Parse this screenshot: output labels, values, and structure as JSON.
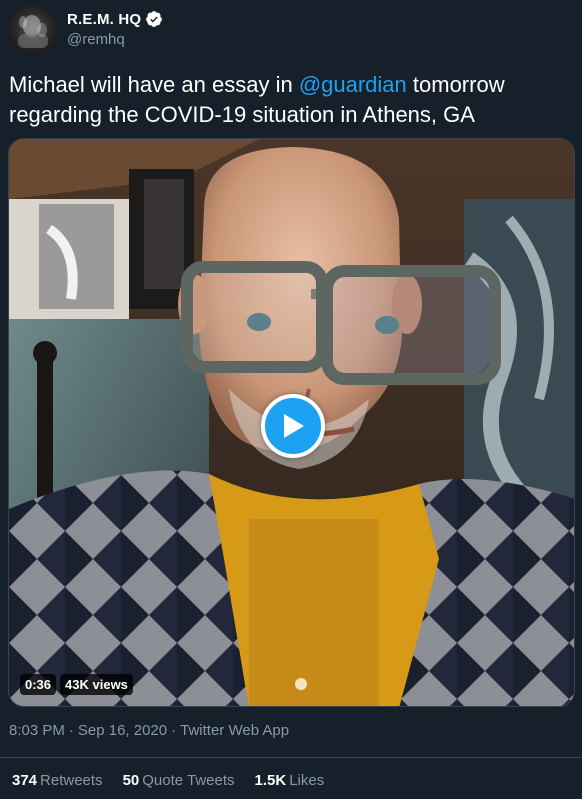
{
  "account": {
    "display_name": "R.E.M. HQ",
    "handle": "@remhq",
    "verified": true
  },
  "tweet": {
    "text_before": "Michael will have an essay in ",
    "mention": "@guardian",
    "text_after": " tomorrow regarding the COVID-19 situation in Athens, GA"
  },
  "video": {
    "duration": "0:36",
    "views": "43K views",
    "play_icon": "play-icon"
  },
  "meta": {
    "time": "8:03 PM",
    "separator": "·",
    "date": "Sep 16, 2020",
    "source": "Twitter Web App"
  },
  "stats": [
    {
      "count": "374",
      "label": "Retweets"
    },
    {
      "count": "50",
      "label": "Quote Tweets"
    },
    {
      "count": "1.5K",
      "label": "Likes"
    }
  ],
  "colors": {
    "background": "#15202b",
    "accent": "#1da1f2",
    "secondary_text": "#8899a6",
    "border": "#38444d"
  }
}
